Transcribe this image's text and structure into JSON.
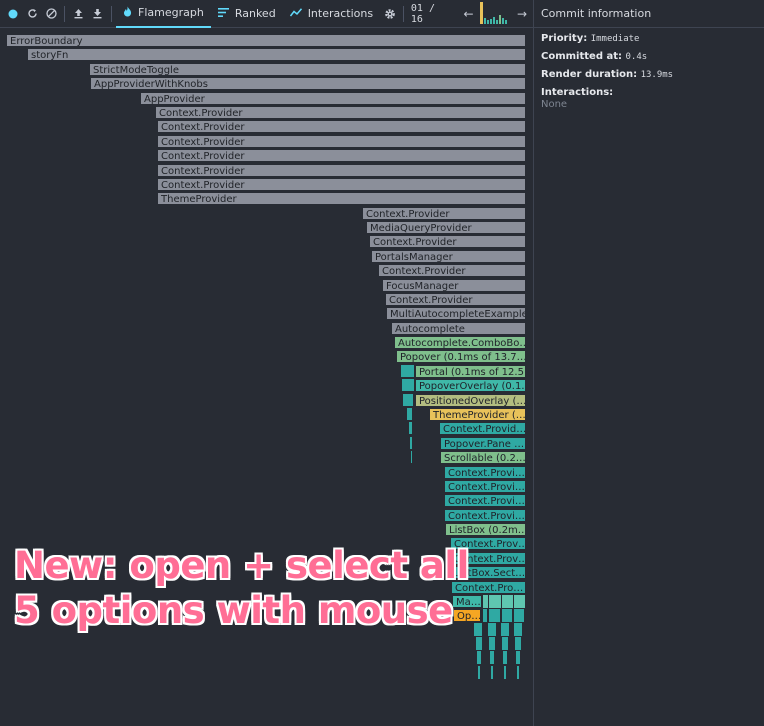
{
  "toolbar": {
    "icons": [
      "record-icon",
      "reload-icon",
      "clear-icon",
      "load-profile-icon",
      "save-profile-icon"
    ],
    "tabs": [
      {
        "label": "Flamegraph",
        "icon": "flame-icon",
        "active": true
      },
      {
        "label": "Ranked",
        "icon": "ranked-icon",
        "active": false
      },
      {
        "label": "Interactions",
        "icon": "interactions-icon",
        "active": false
      }
    ],
    "commit_counter": "01 / 16",
    "prev_arrow": "←",
    "next_arrow": "→"
  },
  "sidebar": {
    "title": "Commit information",
    "priority_label": "Priority",
    "priority_value": "Immediate",
    "committed_label": "Committed at",
    "committed_value": "0.4s",
    "render_label": "Render duration",
    "render_value": "13.9ms",
    "interactions_label": "Interactions",
    "interactions_value": "None"
  },
  "flamegraph": {
    "nodes": [
      "ErrorBoundary",
      "storyFn",
      "StrictModeToggle",
      "AppProviderWithKnobs",
      "AppProvider",
      "Context.Provider",
      "Context.Provider",
      "Context.Provider",
      "Context.Provider",
      "Context.Provider",
      "Context.Provider",
      "ThemeProvider",
      "Context.Provider",
      "MediaQueryProvider",
      "Context.Provider",
      "PortalsManager",
      "Context.Provider",
      "FocusManager",
      "Context.Provider",
      "MultiAutocompleteExample",
      "Autocomplete",
      "Autocomplete.ComboBo…",
      "Popover (0.1ms of 13.7…",
      "Portal (0.1ms of 12.5…",
      "PopoverOverlay (0.1…",
      "PositionedOverlay (…",
      "ThemeProvider (…",
      "Context.Provid…",
      "Popover.Pane …",
      "Scrollable (0.2…",
      "Context.Provi…",
      "Context.Provi…",
      "Context.Provi…",
      "Context.Provi…",
      "ListBox (0.2m…",
      "Context.Prov…",
      "Context.Prov…",
      "ListBox.Sect…",
      "Context.Pro…",
      "Ma…",
      "Op…"
    ]
  },
  "colors": {
    "gray": "#8b8f9a",
    "green": "#7fbf8c",
    "teal": "#2fa9a3",
    "tealLight": "#3fb8a8",
    "olive": "#b3bd80",
    "yellow": "#e8c25a",
    "orange": "#f5a623",
    "accent": "#61dafb",
    "overlay": "#ff6e95"
  },
  "overlay": {
    "line1": "New: open + select all",
    "line2": "5 options with mouse"
  }
}
